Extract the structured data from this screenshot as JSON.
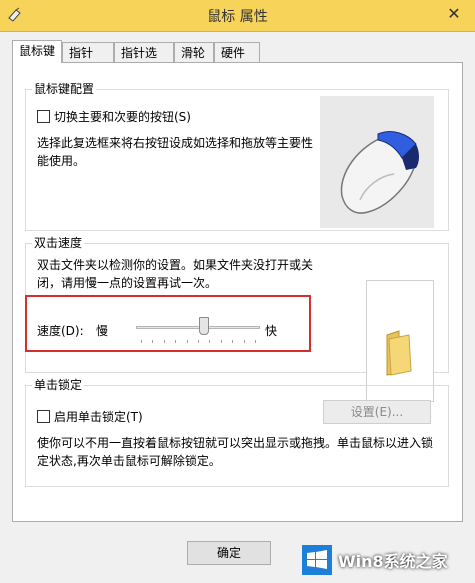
{
  "window": {
    "title": "鼠标 属性",
    "close_glyph": "✕"
  },
  "tabs": [
    {
      "label": "鼠标键",
      "active": true
    },
    {
      "label": "指针"
    },
    {
      "label": "指针选项"
    },
    {
      "label": "滑轮"
    },
    {
      "label": "硬件"
    }
  ],
  "button_config": {
    "title": "鼠标键配置",
    "switch_label": "切换主要和次要的按钮(S)",
    "switch_checked": false,
    "description": "选择此复选框来将右按钮设成如选择和拖放等主要性能使用。"
  },
  "double_click": {
    "title": "双击速度",
    "description": "双击文件夹以检测你的设置。如果文件夹没打开或关闭，请用慢一点的设置再试一次。",
    "speed_label": "速度(D):",
    "slow": "慢",
    "fast": "快",
    "speed_value": 0.55
  },
  "click_lock": {
    "title": "单击锁定",
    "enable_label": "启用单击锁定(T)",
    "enable_checked": false,
    "settings_button": "设置(E)...",
    "description": "使你可以不用一直按着鼠标按钮就可以突出显示或拖拽。单击鼠标以进入锁定状态,再次单击鼠标可解除锁定。"
  },
  "footer": {
    "ok_label": "确定"
  },
  "watermark": {
    "text": "Win8系统之家"
  },
  "icons": [
    "mouse-properties-icon",
    "close-icon",
    "mouse-illustration-icon",
    "folder-icon",
    "windows-logo-icon"
  ]
}
